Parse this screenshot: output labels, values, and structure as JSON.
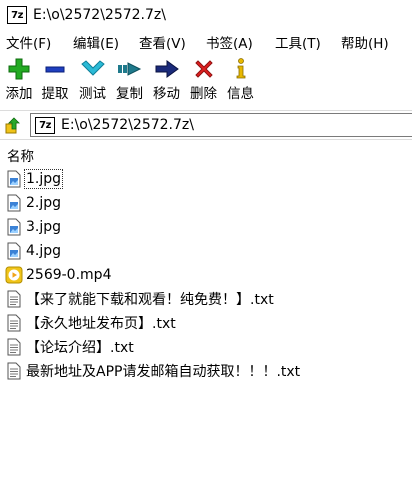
{
  "window": {
    "title": "E:\\o\\2572\\2572.7z\\",
    "app_badge": "7z"
  },
  "menu": [
    "文件(F)",
    "编辑(E)",
    "查看(V)",
    "书签(A)",
    "工具(T)",
    "帮助(H)"
  ],
  "toolbar": [
    {
      "label": "添加",
      "icon": "add-icon"
    },
    {
      "label": "提取",
      "icon": "extract-icon"
    },
    {
      "label": "测试",
      "icon": "test-icon"
    },
    {
      "label": "复制",
      "icon": "copy-icon"
    },
    {
      "label": "移动",
      "icon": "move-icon"
    },
    {
      "label": "删除",
      "icon": "delete-icon"
    },
    {
      "label": "信息",
      "icon": "info-icon"
    }
  ],
  "address": {
    "path": "E:\\o\\2572\\2572.7z\\"
  },
  "list": {
    "column_name": "名称",
    "files": [
      {
        "name": "1.jpg",
        "type": "image"
      },
      {
        "name": "2.jpg",
        "type": "image"
      },
      {
        "name": "3.jpg",
        "type": "image"
      },
      {
        "name": "4.jpg",
        "type": "image"
      },
      {
        "name": "2569-0.mp4",
        "type": "video"
      },
      {
        "name": "【来了就能下载和观看！纯免费！】.txt",
        "type": "text"
      },
      {
        "name": "【永久地址发布页】.txt",
        "type": "text"
      },
      {
        "name": "【论坛介绍】.txt",
        "type": "text"
      },
      {
        "name": "最新地址及APP请发邮箱自动获取！！！.txt",
        "type": "text"
      }
    ]
  },
  "colors": {
    "add": "#22aa22",
    "extract": "#1f3fbf",
    "test": "#2bbad6",
    "copy": "#1f7a8c",
    "move": "#1a2a7a",
    "delete": "#e02020",
    "info": "#e8b800",
    "video": "#f0c419"
  }
}
